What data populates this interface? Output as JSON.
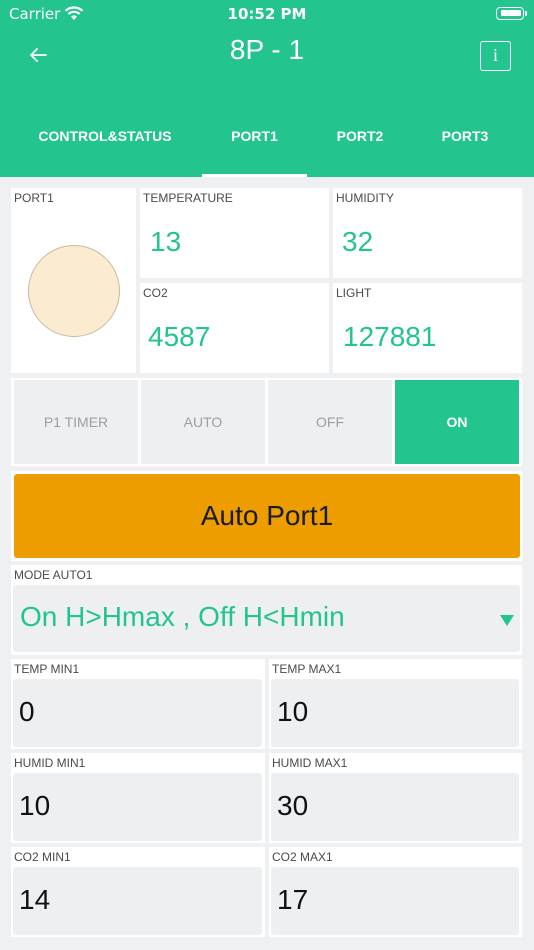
{
  "status_bar": {
    "carrier": "Carrier",
    "time": "10:52 PM"
  },
  "header": {
    "title": "8P - 1",
    "info_label": "i"
  },
  "tabs": [
    {
      "label": "CONTROL&STATUS",
      "active": false
    },
    {
      "label": "PORT1",
      "active": true
    },
    {
      "label": "PORT2",
      "active": false
    },
    {
      "label": "PORT3",
      "active": false
    }
  ],
  "port_status": {
    "label": "PORT1",
    "led_color": "#fbecd1"
  },
  "sensors": {
    "temperature": {
      "label": "TEMPERATURE",
      "value": "13"
    },
    "humidity": {
      "label": "HUMIDITY",
      "value": "32"
    },
    "co2": {
      "label": "CO2",
      "value": "4587"
    },
    "light": {
      "label": "LIGHT",
      "value": "127881"
    }
  },
  "mode_buttons": [
    {
      "label": "P1 TIMER",
      "active": false
    },
    {
      "label": "AUTO",
      "active": false
    },
    {
      "label": "OFF",
      "active": false
    },
    {
      "label": "ON",
      "active": true
    }
  ],
  "auto_button": {
    "label": "Auto Port1",
    "color": "#ed9d00"
  },
  "mode_auto": {
    "label": "MODE AUTO1",
    "value": "On H>Hmax , Off H<Hmin"
  },
  "limits": {
    "temp_min": {
      "label": "TEMP MIN1",
      "value": "0"
    },
    "temp_max": {
      "label": "TEMP MAX1",
      "value": "10"
    },
    "humid_min": {
      "label": "HUMID MIN1",
      "value": "10"
    },
    "humid_max": {
      "label": "HUMID MAX1",
      "value": "30"
    },
    "co2_min": {
      "label": "CO2 MIN1",
      "value": "14"
    },
    "co2_max": {
      "label": "CO2 MAX1",
      "value": "17"
    }
  },
  "colors": {
    "accent": "#23c48e",
    "warning": "#ed9d00",
    "background": "#eef0f1"
  }
}
